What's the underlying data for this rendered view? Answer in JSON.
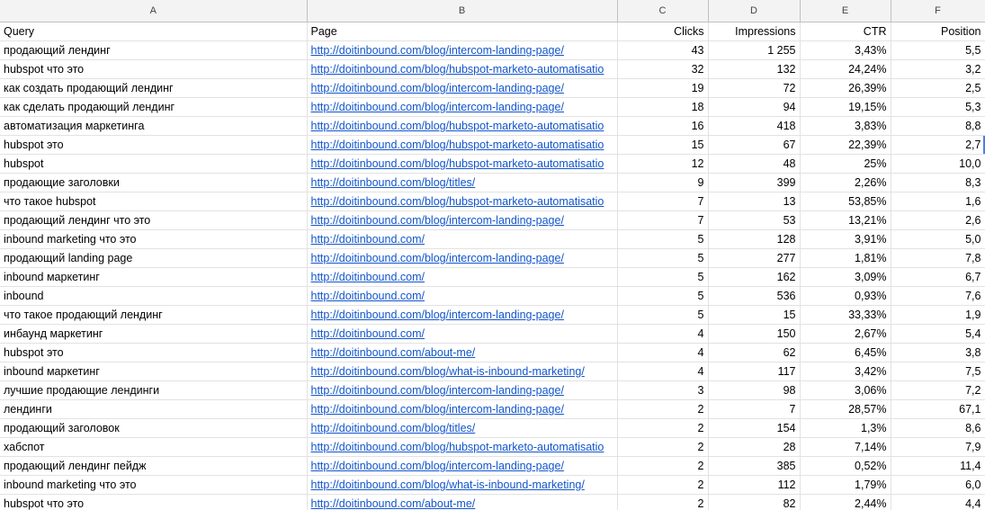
{
  "columns": [
    "A",
    "B",
    "C",
    "D",
    "E",
    "F"
  ],
  "header": {
    "query": "Query",
    "page": "Page",
    "clicks": "Clicks",
    "impressions": "Impressions",
    "ctr": "CTR",
    "position": "Position"
  },
  "rows": [
    {
      "query": "продающий лендинг",
      "page": "http://doitinbound.com/blog/intercom-landing-page/",
      "clicks": "43",
      "impressions": "1 255",
      "ctr": "3,43%",
      "position": "5,5"
    },
    {
      "query": "hubspot что это",
      "page": "http://doitinbound.com/blog/hubspot-marketo-automatisatio",
      "clicks": "32",
      "impressions": "132",
      "ctr": "24,24%",
      "position": "3,2"
    },
    {
      "query": "как создать продающий лендинг",
      "page": "http://doitinbound.com/blog/intercom-landing-page/",
      "clicks": "19",
      "impressions": "72",
      "ctr": "26,39%",
      "position": "2,5"
    },
    {
      "query": "как сделать продающий лендинг",
      "page": "http://doitinbound.com/blog/intercom-landing-page/",
      "clicks": "18",
      "impressions": "94",
      "ctr": "19,15%",
      "position": "5,3"
    },
    {
      "query": "автоматизация маркетинга",
      "page": "http://doitinbound.com/blog/hubspot-marketo-automatisatio",
      "clicks": "16",
      "impressions": "418",
      "ctr": "3,83%",
      "position": "8,8"
    },
    {
      "query": "hubspot это",
      "page": "http://doitinbound.com/blog/hubspot-marketo-automatisatio",
      "clicks": "15",
      "impressions": "67",
      "ctr": "22,39%",
      "position": "2,7"
    },
    {
      "query": "hubspot",
      "page": "http://doitinbound.com/blog/hubspot-marketo-automatisatio",
      "clicks": "12",
      "impressions": "48",
      "ctr": "25%",
      "position": "10,0"
    },
    {
      "query": "продающие заголовки",
      "page": "http://doitinbound.com/blog/titles/",
      "clicks": "9",
      "impressions": "399",
      "ctr": "2,26%",
      "position": "8,3"
    },
    {
      "query": "что такое hubspot",
      "page": "http://doitinbound.com/blog/hubspot-marketo-automatisatio",
      "clicks": "7",
      "impressions": "13",
      "ctr": "53,85%",
      "position": "1,6"
    },
    {
      "query": "продающий лендинг что это",
      "page": "http://doitinbound.com/blog/intercom-landing-page/",
      "clicks": "7",
      "impressions": "53",
      "ctr": "13,21%",
      "position": "2,6"
    },
    {
      "query": "inbound marketing что это",
      "page": "http://doitinbound.com/",
      "clicks": "5",
      "impressions": "128",
      "ctr": "3,91%",
      "position": "5,0"
    },
    {
      "query": "продающий landing page",
      "page": "http://doitinbound.com/blog/intercom-landing-page/",
      "clicks": "5",
      "impressions": "277",
      "ctr": "1,81%",
      "position": "7,8"
    },
    {
      "query": "inbound маркетинг",
      "page": "http://doitinbound.com/",
      "clicks": "5",
      "impressions": "162",
      "ctr": "3,09%",
      "position": "6,7"
    },
    {
      "query": "inbound",
      "page": "http://doitinbound.com/",
      "clicks": "5",
      "impressions": "536",
      "ctr": "0,93%",
      "position": "7,6"
    },
    {
      "query": "что такое продающий лендинг",
      "page": "http://doitinbound.com/blog/intercom-landing-page/",
      "clicks": "5",
      "impressions": "15",
      "ctr": "33,33%",
      "position": "1,9"
    },
    {
      "query": "инбаунд маркетинг",
      "page": "http://doitinbound.com/",
      "clicks": "4",
      "impressions": "150",
      "ctr": "2,67%",
      "position": "5,4"
    },
    {
      "query": "hubspot это",
      "page": "http://doitinbound.com/about-me/",
      "clicks": "4",
      "impressions": "62",
      "ctr": "6,45%",
      "position": "3,8"
    },
    {
      "query": "inbound маркетинг",
      "page": "http://doitinbound.com/blog/what-is-inbound-marketing/",
      "clicks": "4",
      "impressions": "117",
      "ctr": "3,42%",
      "position": "7,5"
    },
    {
      "query": "лучшие продающие лендинги",
      "page": "http://doitinbound.com/blog/intercom-landing-page/",
      "clicks": "3",
      "impressions": "98",
      "ctr": "3,06%",
      "position": "7,2"
    },
    {
      "query": "лендинги",
      "page": "http://doitinbound.com/blog/intercom-landing-page/",
      "clicks": "2",
      "impressions": "7",
      "ctr": "28,57%",
      "position": "67,1"
    },
    {
      "query": "продающий заголовок",
      "page": "http://doitinbound.com/blog/titles/",
      "clicks": "2",
      "impressions": "154",
      "ctr": "1,3%",
      "position": "8,6"
    },
    {
      "query": "хабспот",
      "page": "http://doitinbound.com/blog/hubspot-marketo-automatisatio",
      "clicks": "2",
      "impressions": "28",
      "ctr": "7,14%",
      "position": "7,9"
    },
    {
      "query": "продающий лендинг пейдж",
      "page": "http://doitinbound.com/blog/intercom-landing-page/",
      "clicks": "2",
      "impressions": "385",
      "ctr": "0,52%",
      "position": "11,4"
    },
    {
      "query": "inbound marketing что это",
      "page": "http://doitinbound.com/blog/what-is-inbound-marketing/",
      "clicks": "2",
      "impressions": "112",
      "ctr": "1,79%",
      "position": "6,0"
    },
    {
      "query": "hubspot что это",
      "page": "http://doitinbound.com/about-me/",
      "clicks": "2",
      "impressions": "82",
      "ctr": "2,44%",
      "position": "4,4"
    }
  ]
}
